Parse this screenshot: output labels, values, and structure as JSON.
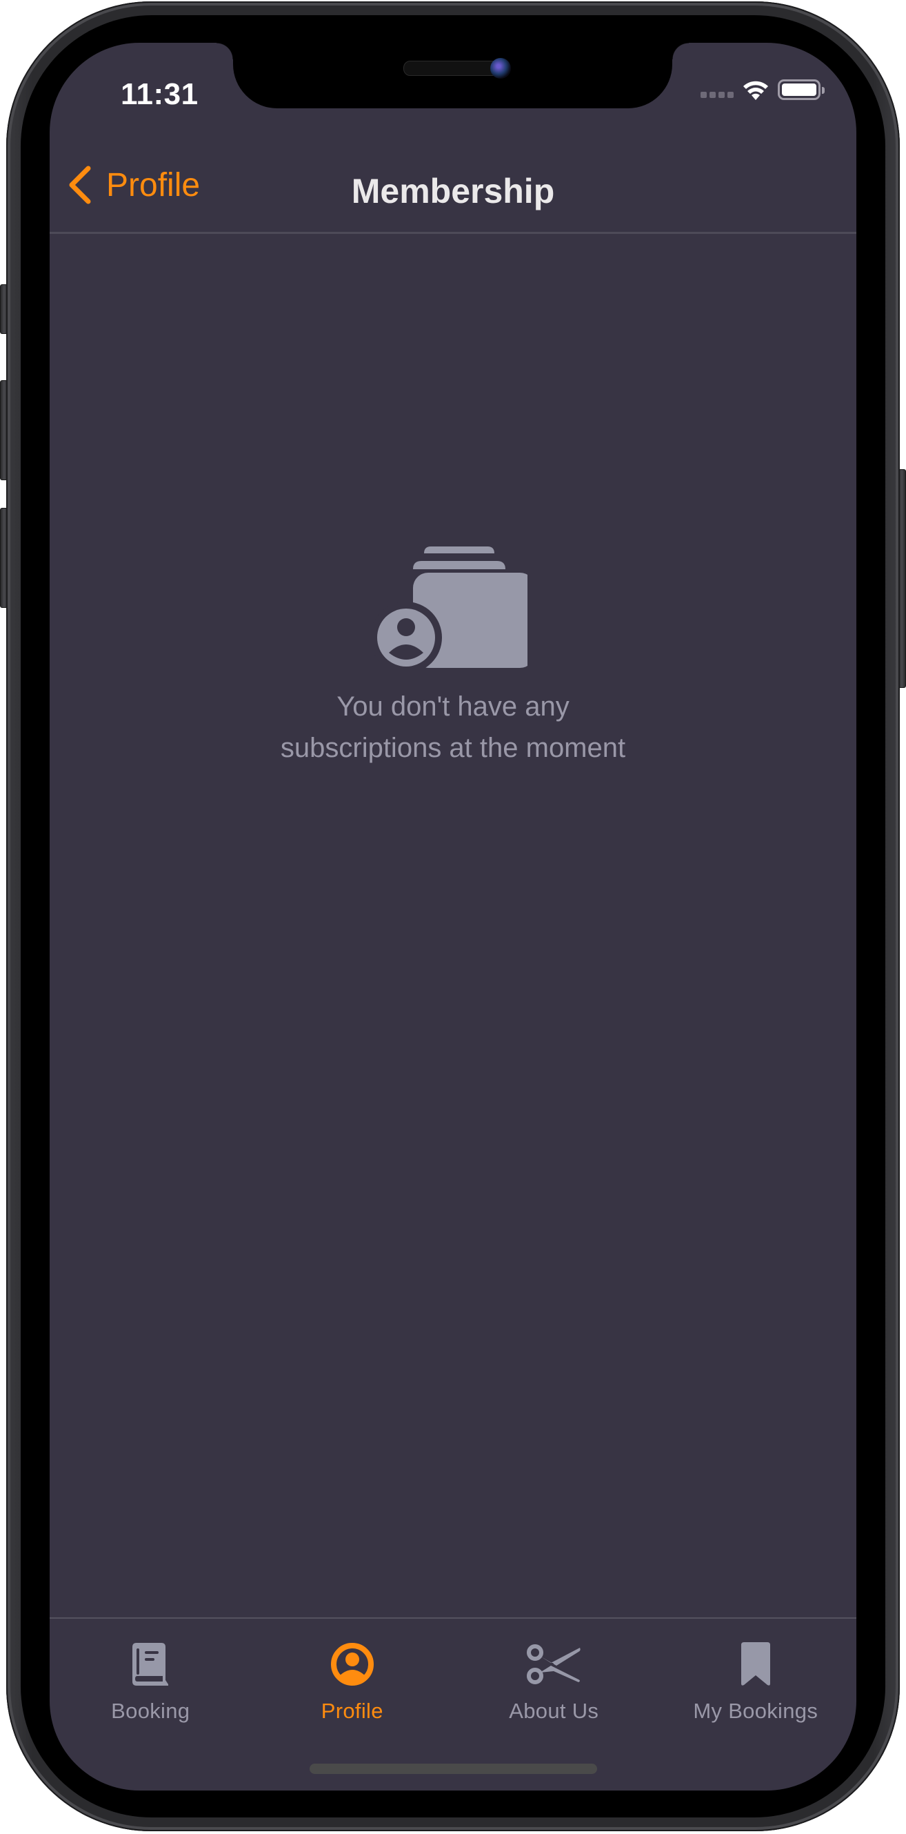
{
  "status_bar": {
    "time": "11:31",
    "icons": [
      "signal-dots-icon",
      "wifi-icon",
      "battery-icon"
    ]
  },
  "navbar": {
    "back_label": "Profile",
    "back_icon": "chevron-left-icon",
    "title": "Membership"
  },
  "empty_state": {
    "icon": "person-cards-icon",
    "line1": "You don't have any",
    "line2": "subscriptions at the moment"
  },
  "tabbar": {
    "tabs": [
      {
        "label": "Booking",
        "icon": "book-icon",
        "active": false
      },
      {
        "label": "Profile",
        "icon": "person-circle-icon",
        "active": true
      },
      {
        "label": "About Us",
        "icon": "scissors-icon",
        "active": false
      },
      {
        "label": "My Bookings",
        "icon": "bookmark-icon",
        "active": false
      }
    ]
  },
  "colors": {
    "accent": "#FF8C0F",
    "background": "#383444",
    "inactive": "#9a98a8",
    "icon_fill": "#9798a8",
    "title": "#ebe9ea"
  }
}
